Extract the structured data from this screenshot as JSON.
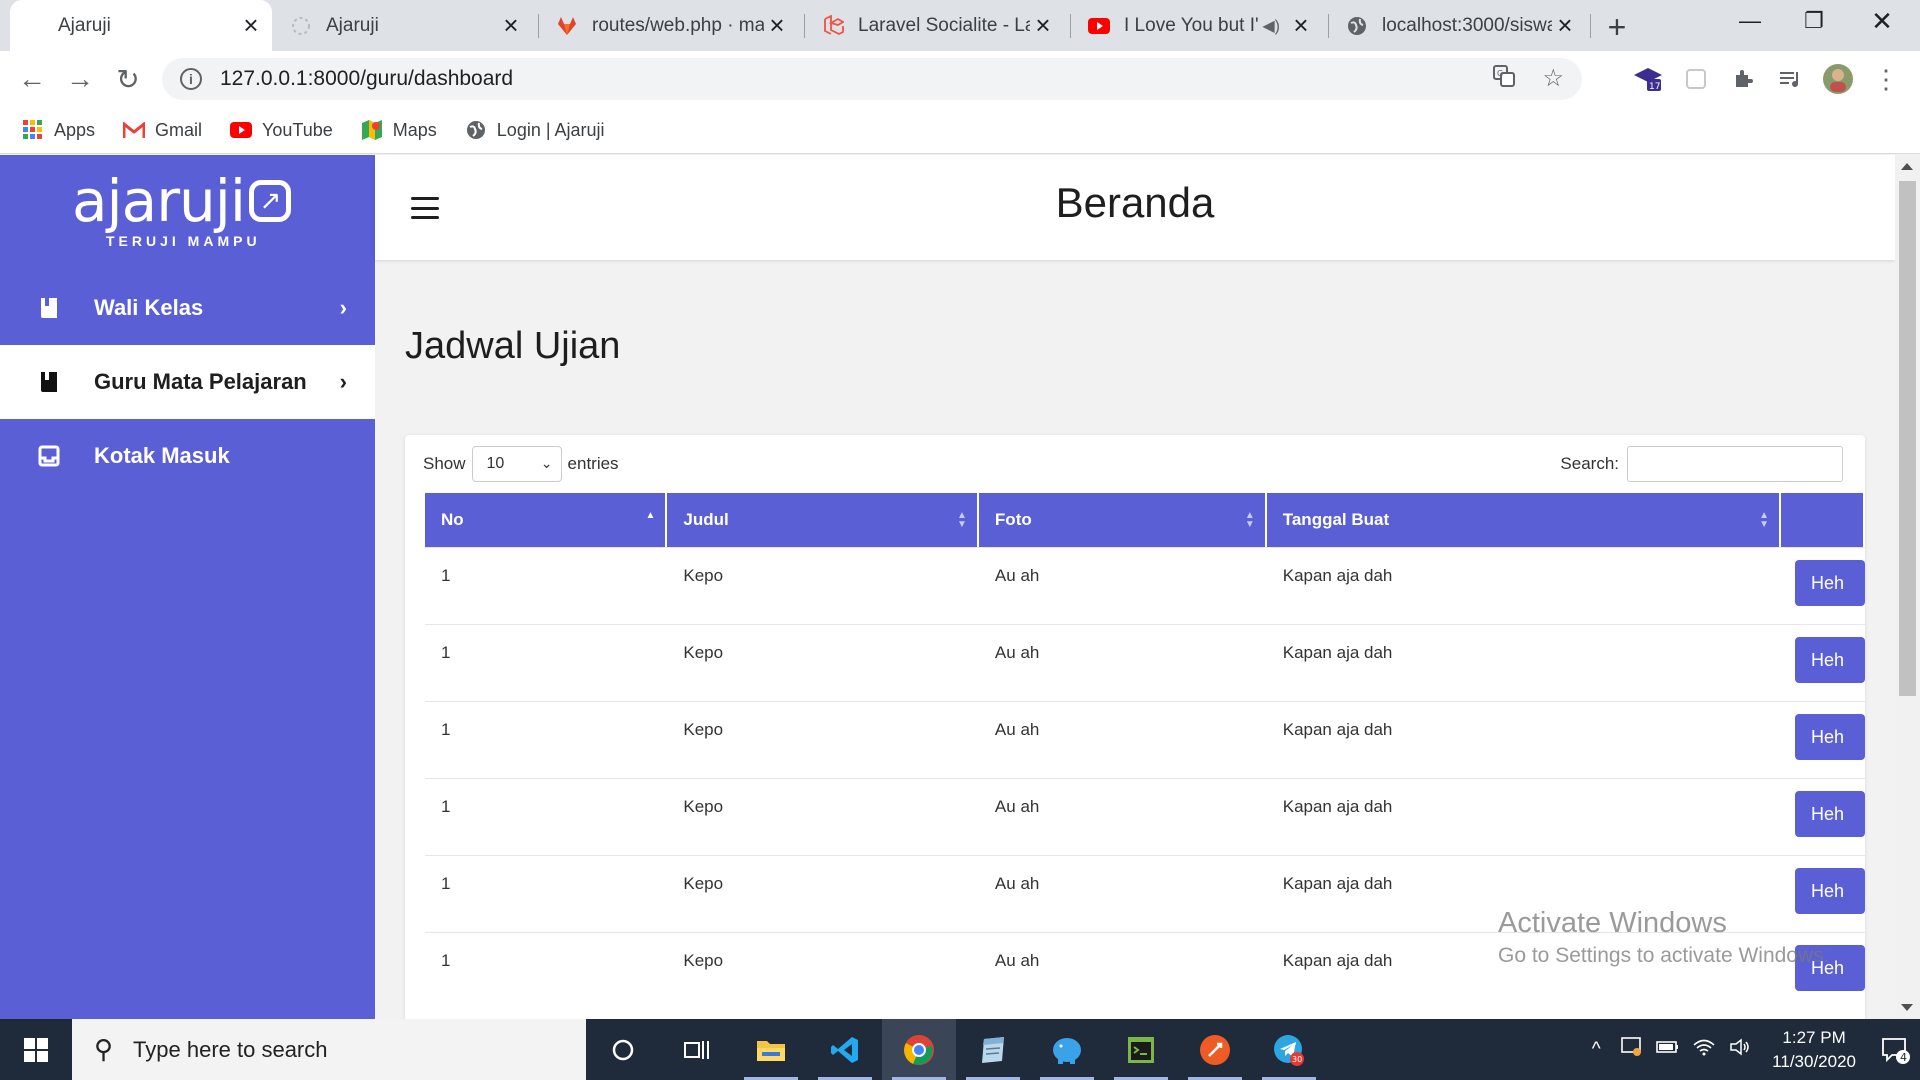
{
  "browser": {
    "tabs": [
      {
        "title": "Ajaruji",
        "active": true,
        "icon": "blank-icon"
      },
      {
        "title": "Ajaruji",
        "active": false,
        "icon": "loading-icon"
      },
      {
        "title": "routes/web.php · ma",
        "active": false,
        "icon": "gitlab-icon"
      },
      {
        "title": "Laravel Socialite - La",
        "active": false,
        "icon": "laravel-icon"
      },
      {
        "title": "I Love You but I'",
        "active": false,
        "icon": "youtube-icon"
      },
      {
        "title": "localhost:3000/siswa",
        "active": false,
        "icon": "globe-icon"
      }
    ],
    "url": "127.0.0.1:8000/guru/dashboard",
    "extension_badge": "17",
    "bookmarks": [
      {
        "label": "Apps",
        "icon": "apps-grid-icon"
      },
      {
        "label": "Gmail",
        "icon": "gmail-icon"
      },
      {
        "label": "YouTube",
        "icon": "youtube-icon"
      },
      {
        "label": "Maps",
        "icon": "maps-icon"
      },
      {
        "label": "Login | Ajaruji",
        "icon": "globe-icon"
      }
    ]
  },
  "sidebar": {
    "logo_text": "ajaruji",
    "tagline": "TERUJI MAMPU",
    "items": [
      {
        "label": "Wali Kelas",
        "active": false,
        "icon": "book-icon"
      },
      {
        "label": "Guru Mata Pelajaran",
        "active": true,
        "icon": "book-icon"
      },
      {
        "label": "Kotak Masuk",
        "active": false,
        "icon": "inbox-icon"
      }
    ]
  },
  "header": {
    "title": "Beranda"
  },
  "main": {
    "section_title": "Jadwal Ujian",
    "show_label": "Show",
    "entries_value": "10",
    "entries_label": "entries",
    "search_label": "Search:",
    "columns": [
      "No",
      "Judul",
      "Foto",
      "Tanggal Buat"
    ],
    "rows": [
      {
        "no": "1",
        "judul": "Kepo",
        "foto": "Au ah",
        "tanggal": "Kapan aja dah",
        "action": "Heh"
      },
      {
        "no": "1",
        "judul": "Kepo",
        "foto": "Au ah",
        "tanggal": "Kapan aja dah",
        "action": "Heh"
      },
      {
        "no": "1",
        "judul": "Kepo",
        "foto": "Au ah",
        "tanggal": "Kapan aja dah",
        "action": "Heh"
      },
      {
        "no": "1",
        "judul": "Kepo",
        "foto": "Au ah",
        "tanggal": "Kapan aja dah",
        "action": "Heh"
      },
      {
        "no": "1",
        "judul": "Kepo",
        "foto": "Au ah",
        "tanggal": "Kapan aja dah",
        "action": "Heh"
      },
      {
        "no": "1",
        "judul": "Kepo",
        "foto": "Au ah",
        "tanggal": "Kapan aja dah",
        "action": "Heh"
      }
    ]
  },
  "watermark": {
    "line1": "Activate Windows",
    "line2": "Go to Settings to activate Windows."
  },
  "taskbar": {
    "search_placeholder": "Type here to search",
    "time": "1:27 PM",
    "date": "11/30/2020",
    "notification_count": "4",
    "telegram_badge": "30"
  },
  "colors": {
    "brand": "#5a5fd6",
    "taskbar": "#1f2a3a"
  }
}
